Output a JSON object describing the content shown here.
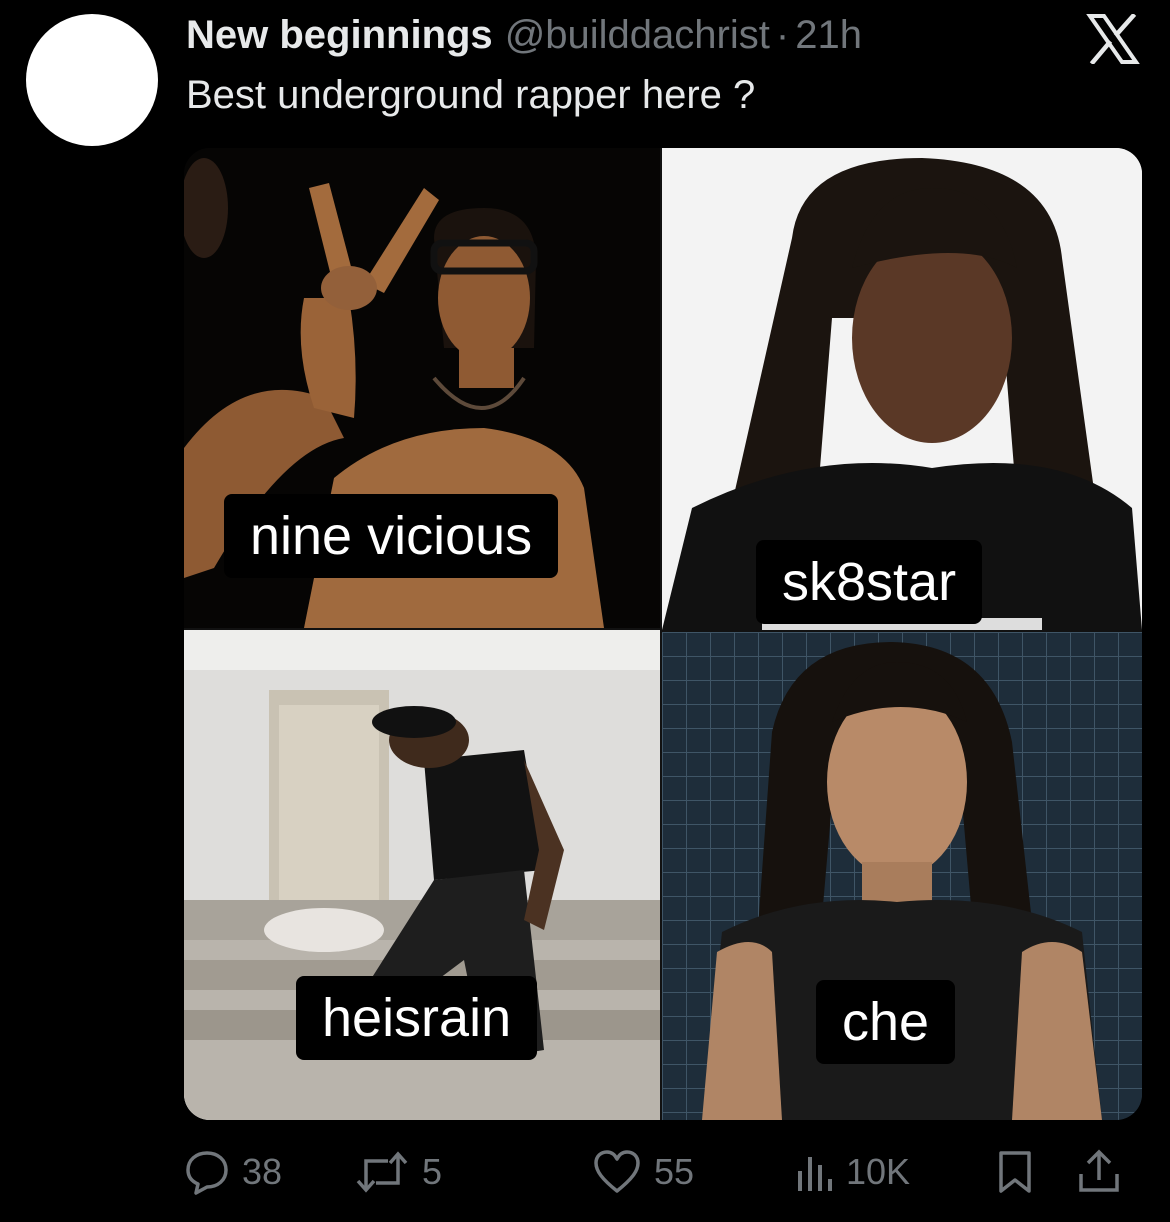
{
  "tweet": {
    "author_name": "New beginnings",
    "author_handle": "@builddachrist",
    "separator": "·",
    "time": "21h",
    "text": "Best underground rapper here ?"
  },
  "media": {
    "labels": [
      "nine vicious",
      "sk8star",
      "heisrain",
      "che"
    ]
  },
  "actions": {
    "reply_count": "38",
    "retweet_count": "5",
    "like_count": "55",
    "views_count": "10K"
  },
  "icons": {
    "reply": "speech-bubble-icon",
    "retweet": "retweet-arrows-icon",
    "like": "heart-icon",
    "views": "bar-chart-icon",
    "bookmark": "bookmark-icon",
    "share": "share-upload-icon",
    "brand": "x-logo-icon"
  },
  "colors": {
    "background": "#000000",
    "primary_text": "#e7e9ea",
    "secondary_text": "#71767b",
    "label_background": "#000000",
    "label_text": "#ffffff"
  }
}
